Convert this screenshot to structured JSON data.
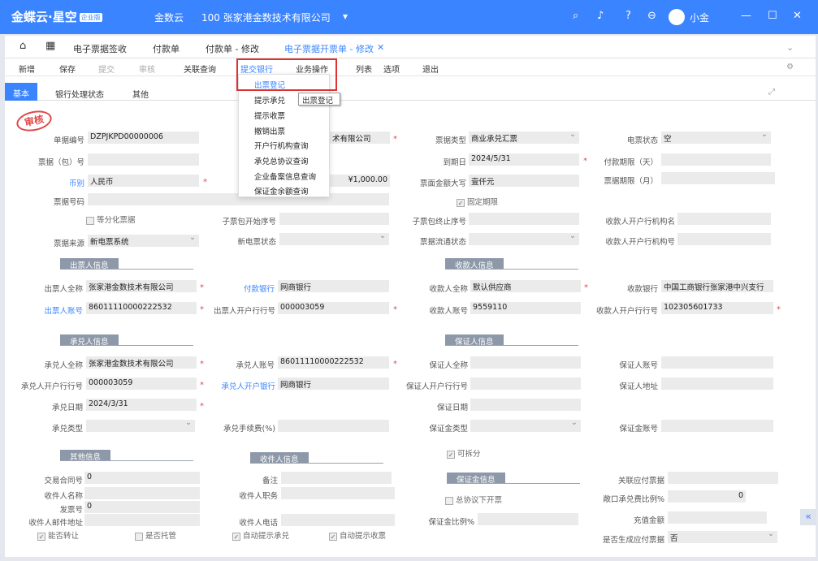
{
  "header": {
    "logo": "金蝶云·星空",
    "badge": "企业版",
    "product": "金数云",
    "company": "100 张家港金数技术有限公司",
    "username": "小金"
  },
  "tabs": [
    "电子票据签收",
    "付款单",
    "付款单 - 修改",
    "电子票据开票单 - 修改"
  ],
  "toolbar": {
    "add": "新增",
    "save": "保存",
    "submit": "提交",
    "audit": "审核",
    "related": "关联查询",
    "submit_bank": "提交银行",
    "business": "业务操作",
    "list": "列表",
    "options": "选项",
    "exit": "退出"
  },
  "subtabs": [
    "基本",
    "银行处理状态",
    "其他"
  ],
  "stamp": "审核",
  "menu": [
    "出票登记",
    "提示承兑",
    "提示收票",
    "撤销出票",
    "开户行机构查询",
    "承兑总协议查询",
    "企业备案信息查询",
    "保证金余额查询"
  ],
  "tooltip": "出票登记",
  "fields": {
    "bill_no_l": "单据编号",
    "bill_no": "DZPJKPD00000006",
    "org_v": "术有限公司",
    "bill_type_l": "票据类型",
    "bill_type": "商业承兑汇票",
    "e_status_l": "电票状态",
    "e_status": "空",
    "pkg_no_l": "票据（包）号",
    "due_l": "到期日",
    "due": "2024/5/31",
    "pay_days_l": "付款期限（天）",
    "currency_l": "币别",
    "currency": "人民币",
    "amount": "¥1,000.00",
    "amount_cn_l": "票面金额大写",
    "amount_cn": "壹仟元",
    "term_l": "票据期限（月）",
    "code_l": "票据号码",
    "fixed_term": "固定期限",
    "split_l": "等分化票据",
    "sub_start_l": "子票包开始序号",
    "sub_end_l": "子票包终止序号",
    "payee_org_l": "收款人开户行机构名",
    "source_l": "票据来源",
    "source": "新电票系统",
    "new_status_l": "新电票状态",
    "flow_status_l": "票据流通状态",
    "payee_org_no_l": "收款人开户行机构号",
    "drawer_sec": "出票人信息",
    "payee_sec": "收款人信息",
    "drawer_name_l": "出票人全称",
    "drawer_name": "张家港金数技术有限公司",
    "pay_bank_l": "付款银行",
    "pay_bank": "网商银行",
    "payee_name_l": "收款人全称",
    "payee_name": "默认供应商",
    "recv_bank_l": "收款银行",
    "recv_bank": "中国工商银行张家港中兴支行",
    "drawer_acct_l": "出票人账号",
    "drawer_acct": "86011110000222532",
    "drawer_bank_no_l": "出票人开户行行号",
    "drawer_bank_no": "000003059",
    "payee_acct_l": "收款人账号",
    "payee_acct": "9559110",
    "payee_bank_no_l": "收款人开户行行号",
    "payee_bank_no": "102305601733",
    "acc_sec": "承兑人信息",
    "guar_sec": "保证人信息",
    "acc_name_l": "承兑人全称",
    "acc_name": "张家港金数技术有限公司",
    "acc_acct_l": "承兑人账号",
    "acc_acct": "86011110000222532",
    "guar_name_l": "保证人全称",
    "guar_acct_l": "保证人账号",
    "acc_bank_no_l": "承兑人开户行行号",
    "acc_bank_no": "000003059",
    "acc_bank_l": "承兑人开户银行",
    "acc_bank": "网商银行",
    "guar_bank_no_l": "保证人开户行行号",
    "guar_addr_l": "保证人地址",
    "acc_date_l": "承兑日期",
    "acc_date": "2024/3/31",
    "guar_date_l": "保证日期",
    "acc_type_l": "承兑类型",
    "acc_fee_l": "承兑手续费(%)",
    "margin_type_l": "保证金类型",
    "margin_acct_l": "保证金账号",
    "other_sec": "其他信息",
    "recv_sec": "收件人信息",
    "margin_sec": "保证金信息",
    "splittable": "可拆分",
    "contract_l": "交易合同号",
    "contract": "0",
    "remark_l": "备注",
    "related_l": "关联应付票据",
    "recv_name_l": "收件人名称",
    "recv_job_l": "收件人职务",
    "total_agree": "总协议下开票",
    "ratio_l": "敞口承兑费比例%",
    "ratio": "0",
    "invoice_l": "发票号",
    "invoice": "0",
    "margin_ratio_l": "保证金比例%",
    "deposit_l": "充值金额",
    "recv_mail_l": "收件人邮件地址",
    "recv_tel_l": "收件人电话",
    "transferable": "能否转让",
    "custody": "是否托管",
    "auto_acc": "自动提示承兑",
    "auto_recv": "自动提示收票",
    "gen_payable_l": "是否生成应付票据",
    "gen_payable": "否"
  }
}
